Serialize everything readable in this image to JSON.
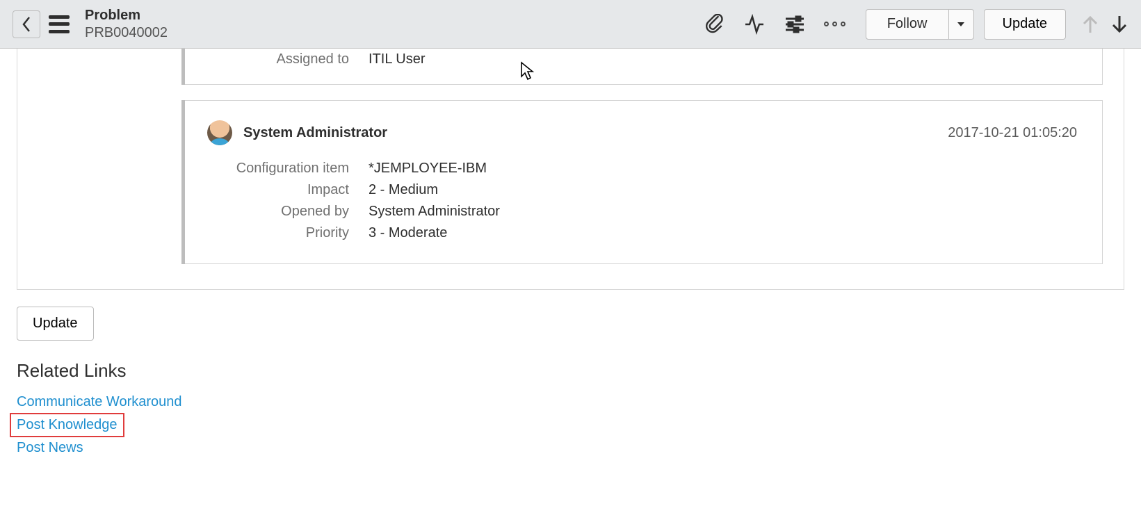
{
  "header": {
    "title": "Problem",
    "record_number": "PRB0040002",
    "follow_label": "Follow",
    "update_label": "Update"
  },
  "activity_top": {
    "fields": [
      {
        "label": "Assigned to",
        "value": "ITIL User"
      }
    ]
  },
  "activity_card": {
    "author": "System Administrator",
    "timestamp": "2017-10-21 01:05:20",
    "fields": [
      {
        "label": "Configuration item",
        "value": "*JEMPLOYEE-IBM"
      },
      {
        "label": "Impact",
        "value": "2 - Medium"
      },
      {
        "label": "Opened by",
        "value": "System Administrator"
      },
      {
        "label": "Priority",
        "value": "3 - Moderate"
      }
    ]
  },
  "bottom": {
    "update_label": "Update"
  },
  "related_links": {
    "heading": "Related Links",
    "items": [
      {
        "label": "Communicate Workaround",
        "highlighted": false
      },
      {
        "label": "Post Knowledge",
        "highlighted": true
      },
      {
        "label": "Post News",
        "highlighted": false
      }
    ]
  }
}
